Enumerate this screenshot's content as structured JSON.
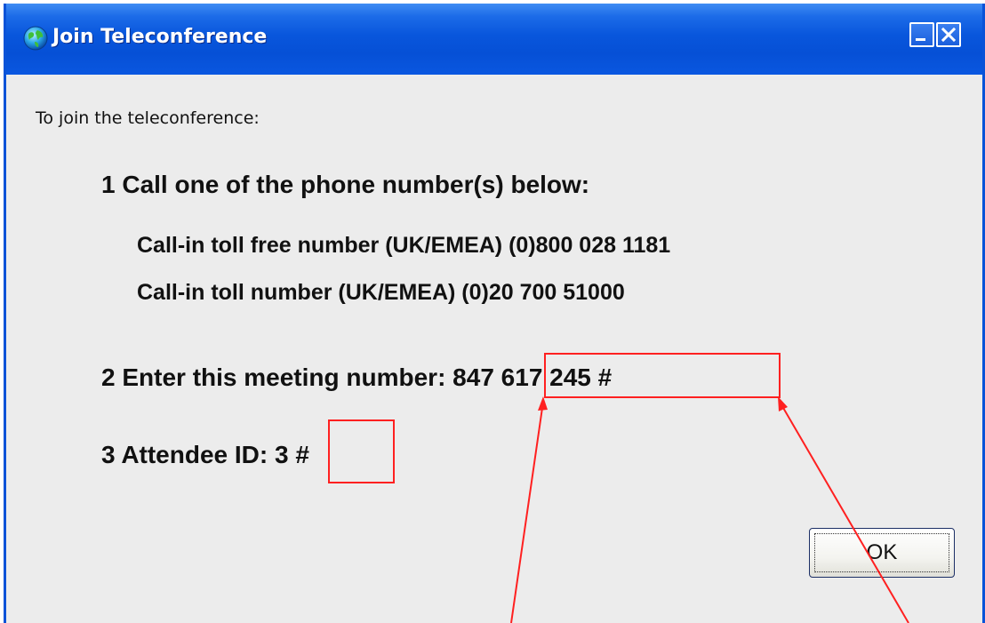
{
  "window": {
    "title": "Join Teleconference"
  },
  "dialog": {
    "intro": "To join the teleconference:",
    "step1": {
      "heading": "1  Call one of the phone number(s) below:",
      "phones": [
        "Call-in toll free number (UK/EMEA) (0)800 028 1181",
        "Call-in toll number (UK/EMEA) (0)20 700 51000"
      ]
    },
    "step2": {
      "label": "2  Enter this meeting number: ",
      "value": "847 617 245  #"
    },
    "step3": {
      "label": "3  Attendee ID: ",
      "value": "3 #"
    },
    "ok_label": "OK"
  },
  "icons": {
    "app": "globe-icon",
    "minimize": "minimize-icon",
    "close": "close-icon"
  },
  "colors": {
    "titlebar": "#0856dc",
    "annotation": "#ff2020",
    "background": "#ececec"
  }
}
